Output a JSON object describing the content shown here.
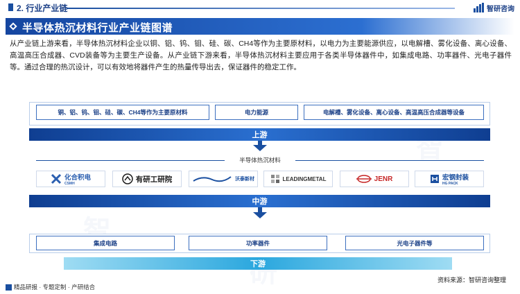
{
  "header": {
    "section_title": "2. 行业产业链",
    "brand": "智研咨询"
  },
  "banner": {
    "title": "半导体热沉材料行业产业链图谱"
  },
  "intro": {
    "text": "从产业链上游来看，半导体热沉材料企业以铜、铝、钨、钼、硅、碳、CH4等作为主要原材料，以电力为主要能源供应，以电解槽、雾化设备、离心设备、高温高压合成器、CVD装备等为主要生产设备。从产业链下游来看，半导体热沉材料主要应用于各类半导体器件中，如集成电路、功率器件、光电子器件等。通过合理的热沉设计，可以有效地将器件产生的热量传导出去，保证器件的稳定工作。"
  },
  "upstream": {
    "items": [
      "铜、铝、钨、钼、硅、碳、CH4等作为主要原材料",
      "电力能源",
      "电解槽、雾化设备、离心设备、高温高压合成器等设备"
    ],
    "stage_label": "上游"
  },
  "midstream": {
    "label": "半导体热沉材料",
    "stage_label": "中游",
    "logos": [
      {
        "text": "化合积电",
        "sub": "CSMH",
        "color": "#2b5fb0",
        "icon": "csmh-logo-icon"
      },
      {
        "text": "有研工研院",
        "sub": "",
        "color": "#1a1a1a",
        "icon": "youyan-logo-icon"
      },
      {
        "text": "沃泰新材",
        "sub": "",
        "color": "#1a4fa0",
        "icon": "wotai-logo-icon"
      },
      {
        "text": "LEADINGMETAL",
        "sub": "",
        "color": "#333333",
        "icon": "leadingmetal-logo-icon"
      },
      {
        "text": "JENR",
        "sub": "",
        "color": "#c62828",
        "icon": "jenr-logo-icon"
      },
      {
        "text": "宏钢封装",
        "sub": "HG PACK",
        "color": "#1a4fa0",
        "icon": "hgpack-logo-icon"
      }
    ]
  },
  "downstream": {
    "items": [
      "集成电路",
      "功率器件",
      "光电子器件等"
    ],
    "stage_label": "下游"
  },
  "footer": {
    "tags": "精品研报 · 专题定制 · 产研结合",
    "source": "资料来源：智研咨询整理"
  },
  "colors": {
    "primary": "#1a4fa0",
    "banner": "#1546a0",
    "downstream": "#2aa7de"
  }
}
